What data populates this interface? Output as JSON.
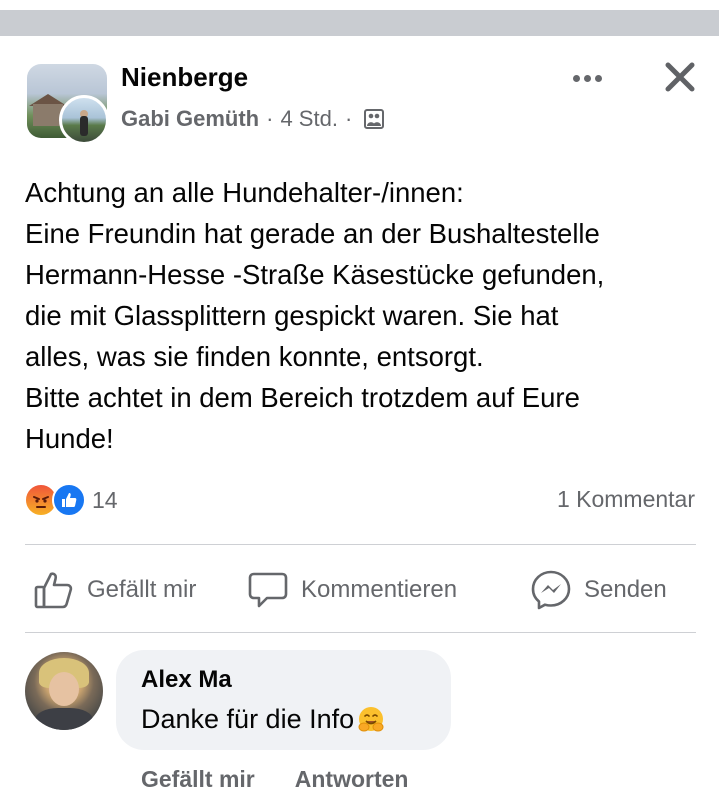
{
  "header": {
    "group_name": "Nienberge",
    "author": "Gabi Gemüth",
    "separator": "·",
    "time": "4 Std.",
    "privacy_icon": "group-privacy-icon"
  },
  "post": {
    "lines": [
      "Achtung an alle Hundehalter-/innen:",
      "Eine Freundin hat gerade an der Bushaltestelle",
      "Hermann-Hesse -Straße Käsestücke gefunden,",
      "die mit Glassplittern gespickt waren. Sie hat",
      "alles, was sie finden konnte, entsorgt.",
      "Bitte achtet in dem Bereich trotzdem auf Eure",
      "Hunde!"
    ]
  },
  "stats": {
    "reaction_count": "14",
    "comment_count": "1 Kommentar"
  },
  "actions": {
    "like": "Gefällt mir",
    "comment": "Kommentieren",
    "send": "Senden"
  },
  "comment": {
    "author": "Alex Ma",
    "text": "Danke für die Info",
    "emoji": "smiling-face-with-open-hands-icon",
    "like": "Gefällt mir",
    "reply": "Antworten"
  },
  "colors": {
    "accent": "#1877f2",
    "secondary_text": "#65676b",
    "bubble": "#f0f2f5"
  }
}
